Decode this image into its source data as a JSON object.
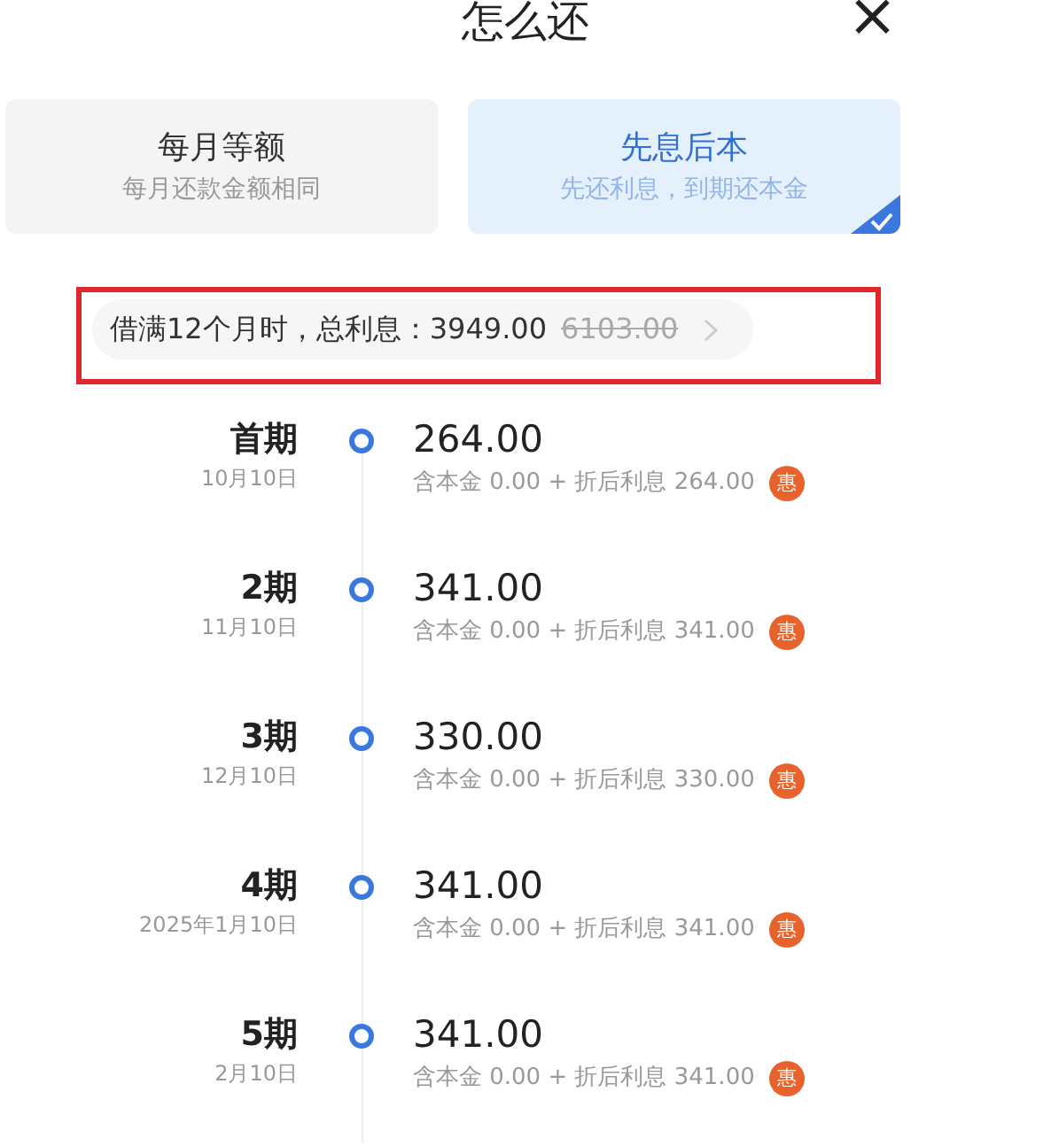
{
  "title": "怎么还",
  "close": "×",
  "plans": [
    {
      "name": "每月等额",
      "desc": "每月还款金额相同",
      "selected": false
    },
    {
      "name": "先息后本",
      "desc": "先还利息，到期还本金",
      "selected": true
    }
  ],
  "summary": {
    "text": "借满12个月时，总利息：3949.00",
    "original": "6103.00",
    "highlighted": true
  },
  "schedule": [
    {
      "period": "首期",
      "date": "10月10日",
      "amount": "264.00",
      "detail": "含本金 0.00 + 折后利息 264.00",
      "badge": "惠"
    },
    {
      "period": "2期",
      "date": "11月10日",
      "amount": "341.00",
      "detail": "含本金 0.00 + 折后利息 341.00",
      "badge": "惠"
    },
    {
      "period": "3期",
      "date": "12月10日",
      "amount": "330.00",
      "detail": "含本金 0.00 + 折后利息 330.00",
      "badge": "惠"
    },
    {
      "period": "4期",
      "date": "2025年1月10日",
      "amount": "341.00",
      "detail": "含本金 0.00 + 折后利息 341.00",
      "badge": "惠"
    },
    {
      "period": "5期",
      "date": "2月10日",
      "amount": "341.00",
      "detail": "含本金 0.00 + 折后利息 341.00",
      "badge": "惠"
    }
  ]
}
